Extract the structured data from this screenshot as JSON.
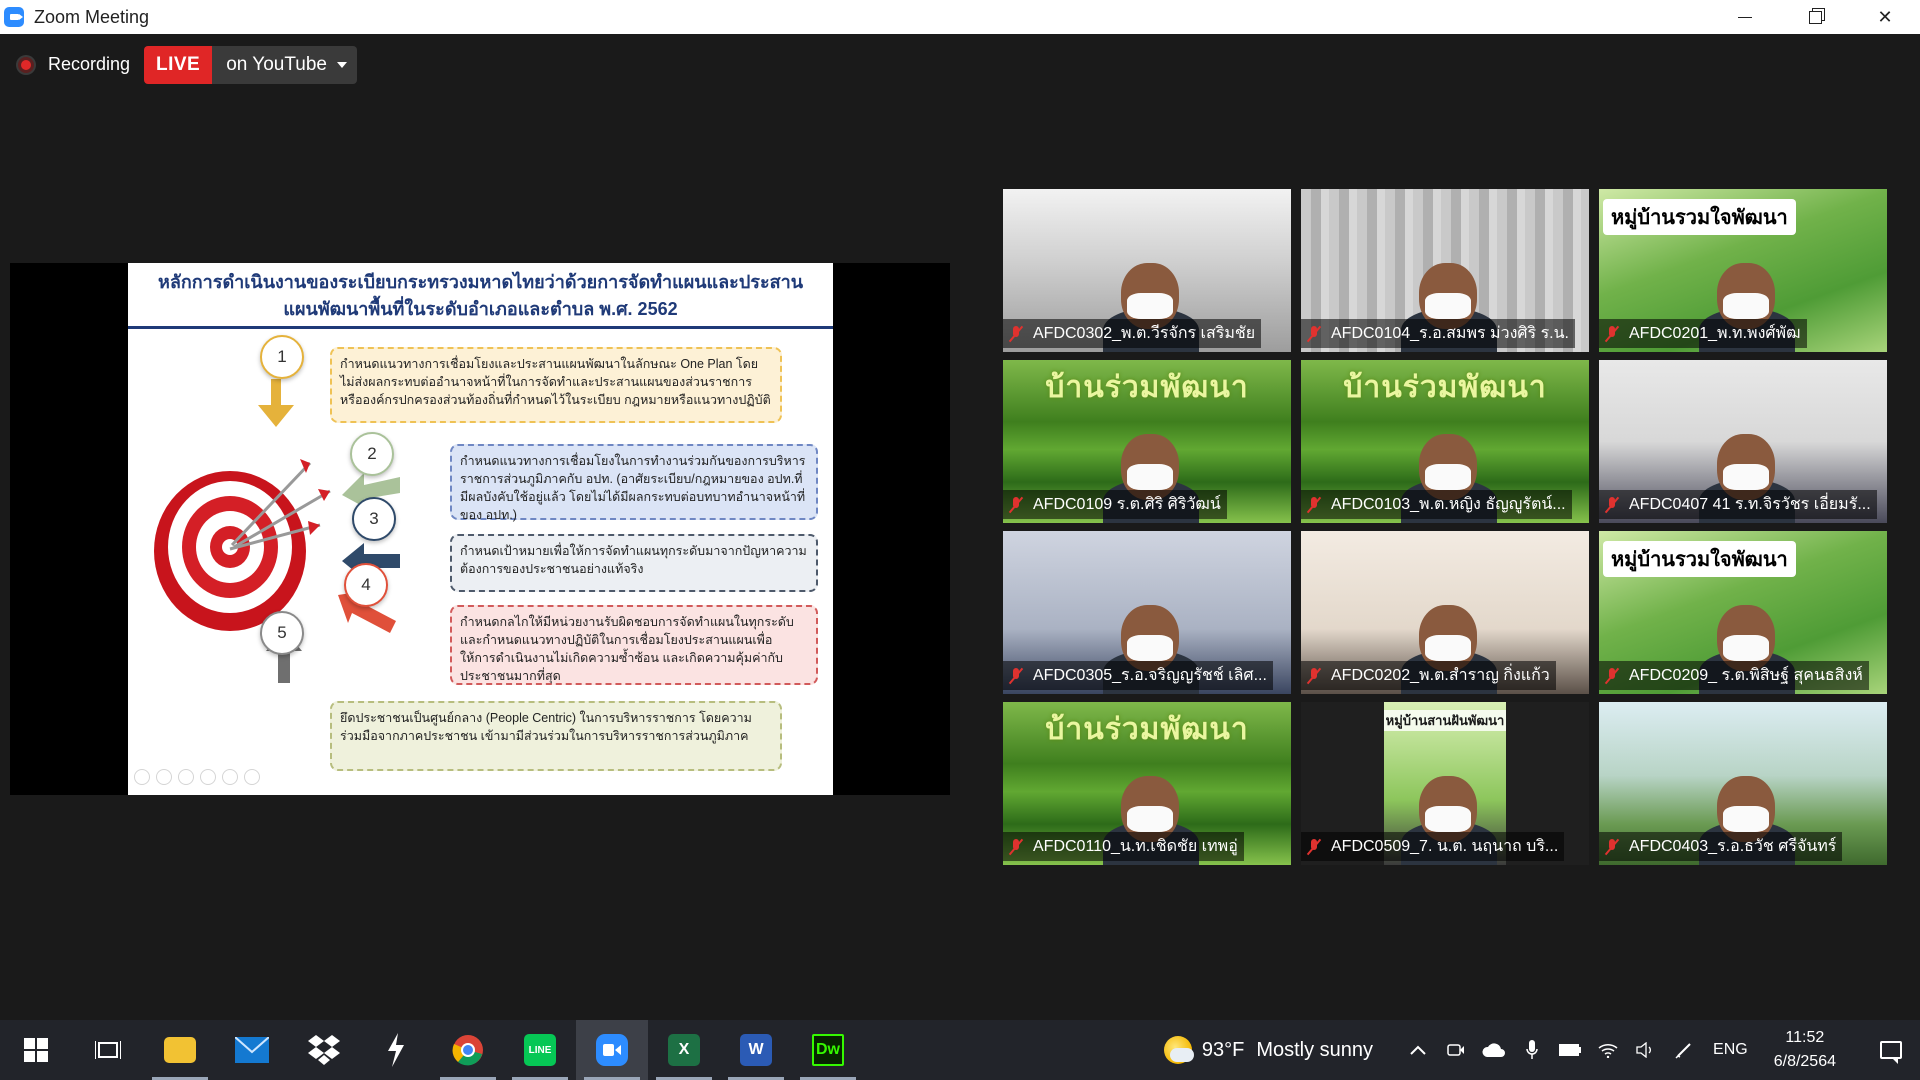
{
  "window": {
    "title": "Zoom Meeting",
    "controls": {
      "minimize": "minimize",
      "restore": "restore",
      "close": "✕"
    }
  },
  "meeting": {
    "recording_label": "Recording",
    "live_badge": "LIVE",
    "live_destination": "on YouTube"
  },
  "slide": {
    "title_line1": "หลักการดำเนินงานของระเบียบกระทรวงมหาดไทยว่าด้วยการจัดทำแผนและประสาน",
    "title_line2": "แผนพัฒนาพื้นที่ในระดับอำเภอและตำบล พ.ศ. 2562",
    "steps": [
      {
        "num": "1",
        "text": "กำหนดแนวทางการเชื่อมโยงและประสานแผนพัฒนาในลักษณะ One Plan โดยไม่ส่งผลกระทบต่ออำนาจหน้าที่ในการจัดทำและประสานแผนของส่วนราชการ หรือองค์กรปกครองส่วนท้องถิ่นที่กำหนดไว้ในระเบียบ กฎหมายหรือแนวทางปฏิบัติ"
      },
      {
        "num": "2",
        "text": "กำหนดแนวทางการเชื่อมโยงในการทำงานร่วมกันของการบริหารราชการส่วนภูมิภาคกับ อปท. (อาศัยระเบียบ/กฎหมายของ อปท.ที่มีผลบังคับใช้อยู่แล้ว โดยไม่ได้มีผลกระทบต่อบทบาทอำนาจหน้าที่ของ อปท.)"
      },
      {
        "num": "3",
        "text": "กำหนดเป้าหมายเพื่อให้การจัดทำแผนทุกระดับมาจากปัญหาความต้องการของประชาชนอย่างแท้จริง"
      },
      {
        "num": "4",
        "text": "กำหนดกลไกให้มีหน่วยงานรับผิดชอบการจัดทำแผนในทุกระดับ และกำหนดแนวทางปฏิบัติในการเชื่อมโยงประสานแผนเพื่อให้การดำเนินงานไม่เกิดความซ้ำซ้อน และเกิดความคุ้มค่ากับประชาชนมากที่สุด"
      },
      {
        "num": "5",
        "text": "ยึดประชาชนเป็นศูนย์กลาง (People Centric) ในการบริหารราชการ โดยความร่วมมือจากภาคประชาชน เข้ามามีส่วนร่วมในการบริหารราชการส่วนภูมิภาค"
      }
    ]
  },
  "participants": [
    {
      "name": "AFDC0302_พ.ต.วีรจักร เสริมชัย",
      "bg": "fog",
      "banner": ""
    },
    {
      "name": "AFDC0104_ร.อ.สมพร ม่วงศิริ ร.น.",
      "bg": "curtain",
      "banner": ""
    },
    {
      "name": "AFDC0201_พ.ท.พงศ์พัฒ",
      "bg": "village",
      "banner": "หมู่บ้านรวมใจพัฒนา"
    },
    {
      "name": "AFDC0109 ร.ต.ศิริ ศิริวัฒน์",
      "bg": "rice",
      "banner_green": "บ้านร่วมพัฒนา"
    },
    {
      "name": "AFDC0103_พ.ต.หญิง ธัญญูรัตน์...",
      "bg": "rice",
      "banner_green": "บ้านร่วมพัฒนา"
    },
    {
      "name": "AFDC0407 41 ร.ท.จิรวัชร เอี่ยมรั...",
      "bg": "room",
      "banner": ""
    },
    {
      "name": "AFDC0305_ร.อ.จริญญรัชช์ เลิศ...",
      "bg": "office",
      "banner": ""
    },
    {
      "name": "AFDC0202_พ.ต.สำราญ กิ่งแก้ว",
      "bg": "wall",
      "banner": ""
    },
    {
      "name": "AFDC0209_ ร.ต.พิสิษฐ์ สุคนธสิงห์",
      "bg": "village",
      "banner": "หมู่บ้านรวมใจพัฒนา"
    },
    {
      "name": "AFDC0110_น.ท.เชิดชัย เทพอู่",
      "bg": "rice",
      "banner_green": "บ้านร่วมพัฒนา"
    },
    {
      "name": "AFDC0509_7. น.ต. นฤนาถ บริ...",
      "bg": "dark",
      "portrait_title": "หมู่บ้านสานฝันพัฒนา"
    },
    {
      "name": "AFDC0403_ร.อ.ธวัช ศรีจันทร์",
      "bg": "farm",
      "banner": ""
    }
  ],
  "taskbar": {
    "apps": [
      {
        "name": "task-view",
        "label": ""
      },
      {
        "name": "file-explorer",
        "label": ""
      },
      {
        "name": "mail",
        "label": ""
      },
      {
        "name": "dropbox",
        "label": ""
      },
      {
        "name": "app-s",
        "label": ""
      },
      {
        "name": "chrome",
        "label": ""
      },
      {
        "name": "line",
        "label": "LINE"
      },
      {
        "name": "zoom",
        "label": ""
      },
      {
        "name": "excel",
        "label": "X"
      },
      {
        "name": "word",
        "label": "W"
      },
      {
        "name": "dreamweaver",
        "label": "Dw"
      }
    ],
    "weather": {
      "temp": "93°F",
      "condition": "Mostly sunny"
    },
    "language": "ENG",
    "time": "11:52",
    "date": "6/8/2564"
  },
  "colors": {
    "zoom_blue": "#2d8cff",
    "live_red": "#e02626",
    "muted_red": "#e0322f",
    "slide_title_blue": "#1f3a78"
  }
}
